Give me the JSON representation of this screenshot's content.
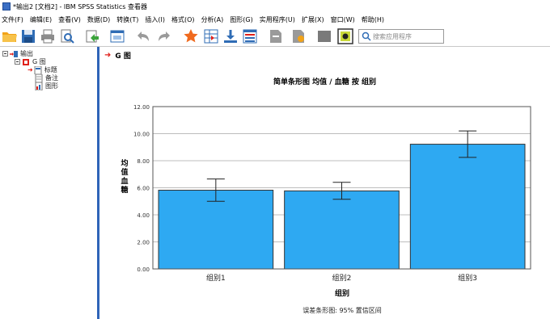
{
  "window": {
    "title": "*输出2 [文档2] - IBM SPSS Statistics 查看器"
  },
  "menu": [
    "文件(F)",
    "编辑(E)",
    "查看(V)",
    "数据(D)",
    "转换(T)",
    "插入(I)",
    "格式(O)",
    "分析(A)",
    "图形(G)",
    "实用程序(U)",
    "扩展(X)",
    "窗口(W)",
    "帮助(H)"
  ],
  "toolbar": {
    "icons": [
      "open-icon",
      "save-icon",
      "print-icon",
      "print-preview-icon",
      "export-icon",
      "recall-dialog-icon",
      "undo-icon",
      "redo-icon",
      "goto-data-icon",
      "goto-case-icon",
      "goto-variable-icon",
      "variables-icon",
      "promote-icon",
      "demote-icon",
      "show-all-icon",
      "insert-output-icon"
    ],
    "search_placeholder": "搜索应用程序"
  },
  "outline": {
    "root": "输出",
    "node": "G 图",
    "children": [
      "标题",
      "备注",
      "图形"
    ]
  },
  "content": {
    "heading": "G 图",
    "chart_title": "简单条形图 均值 / 血糖 按 组别",
    "footnote": "误差条形图: 95% 置信区间"
  },
  "chart_data": {
    "type": "bar",
    "title": "简单条形图 均值 / 血糖 按 组别",
    "xlabel": "组别",
    "ylabel": "均值 血糖",
    "categories": [
      "组别1",
      "组别2",
      "组别3"
    ],
    "values": [
      5.82,
      5.77,
      9.22
    ],
    "error_low": [
      5.0,
      5.15,
      8.25
    ],
    "error_high": [
      6.65,
      6.4,
      10.2
    ],
    "ylim": [
      0,
      12
    ],
    "yticks": [
      "0.00",
      "2.00",
      "4.00",
      "6.00",
      "8.00",
      "10.00",
      "12.00"
    ],
    "grid": true,
    "bar_color": "#2ea9f2",
    "note": "误差条形图: 95% 置信区间"
  }
}
